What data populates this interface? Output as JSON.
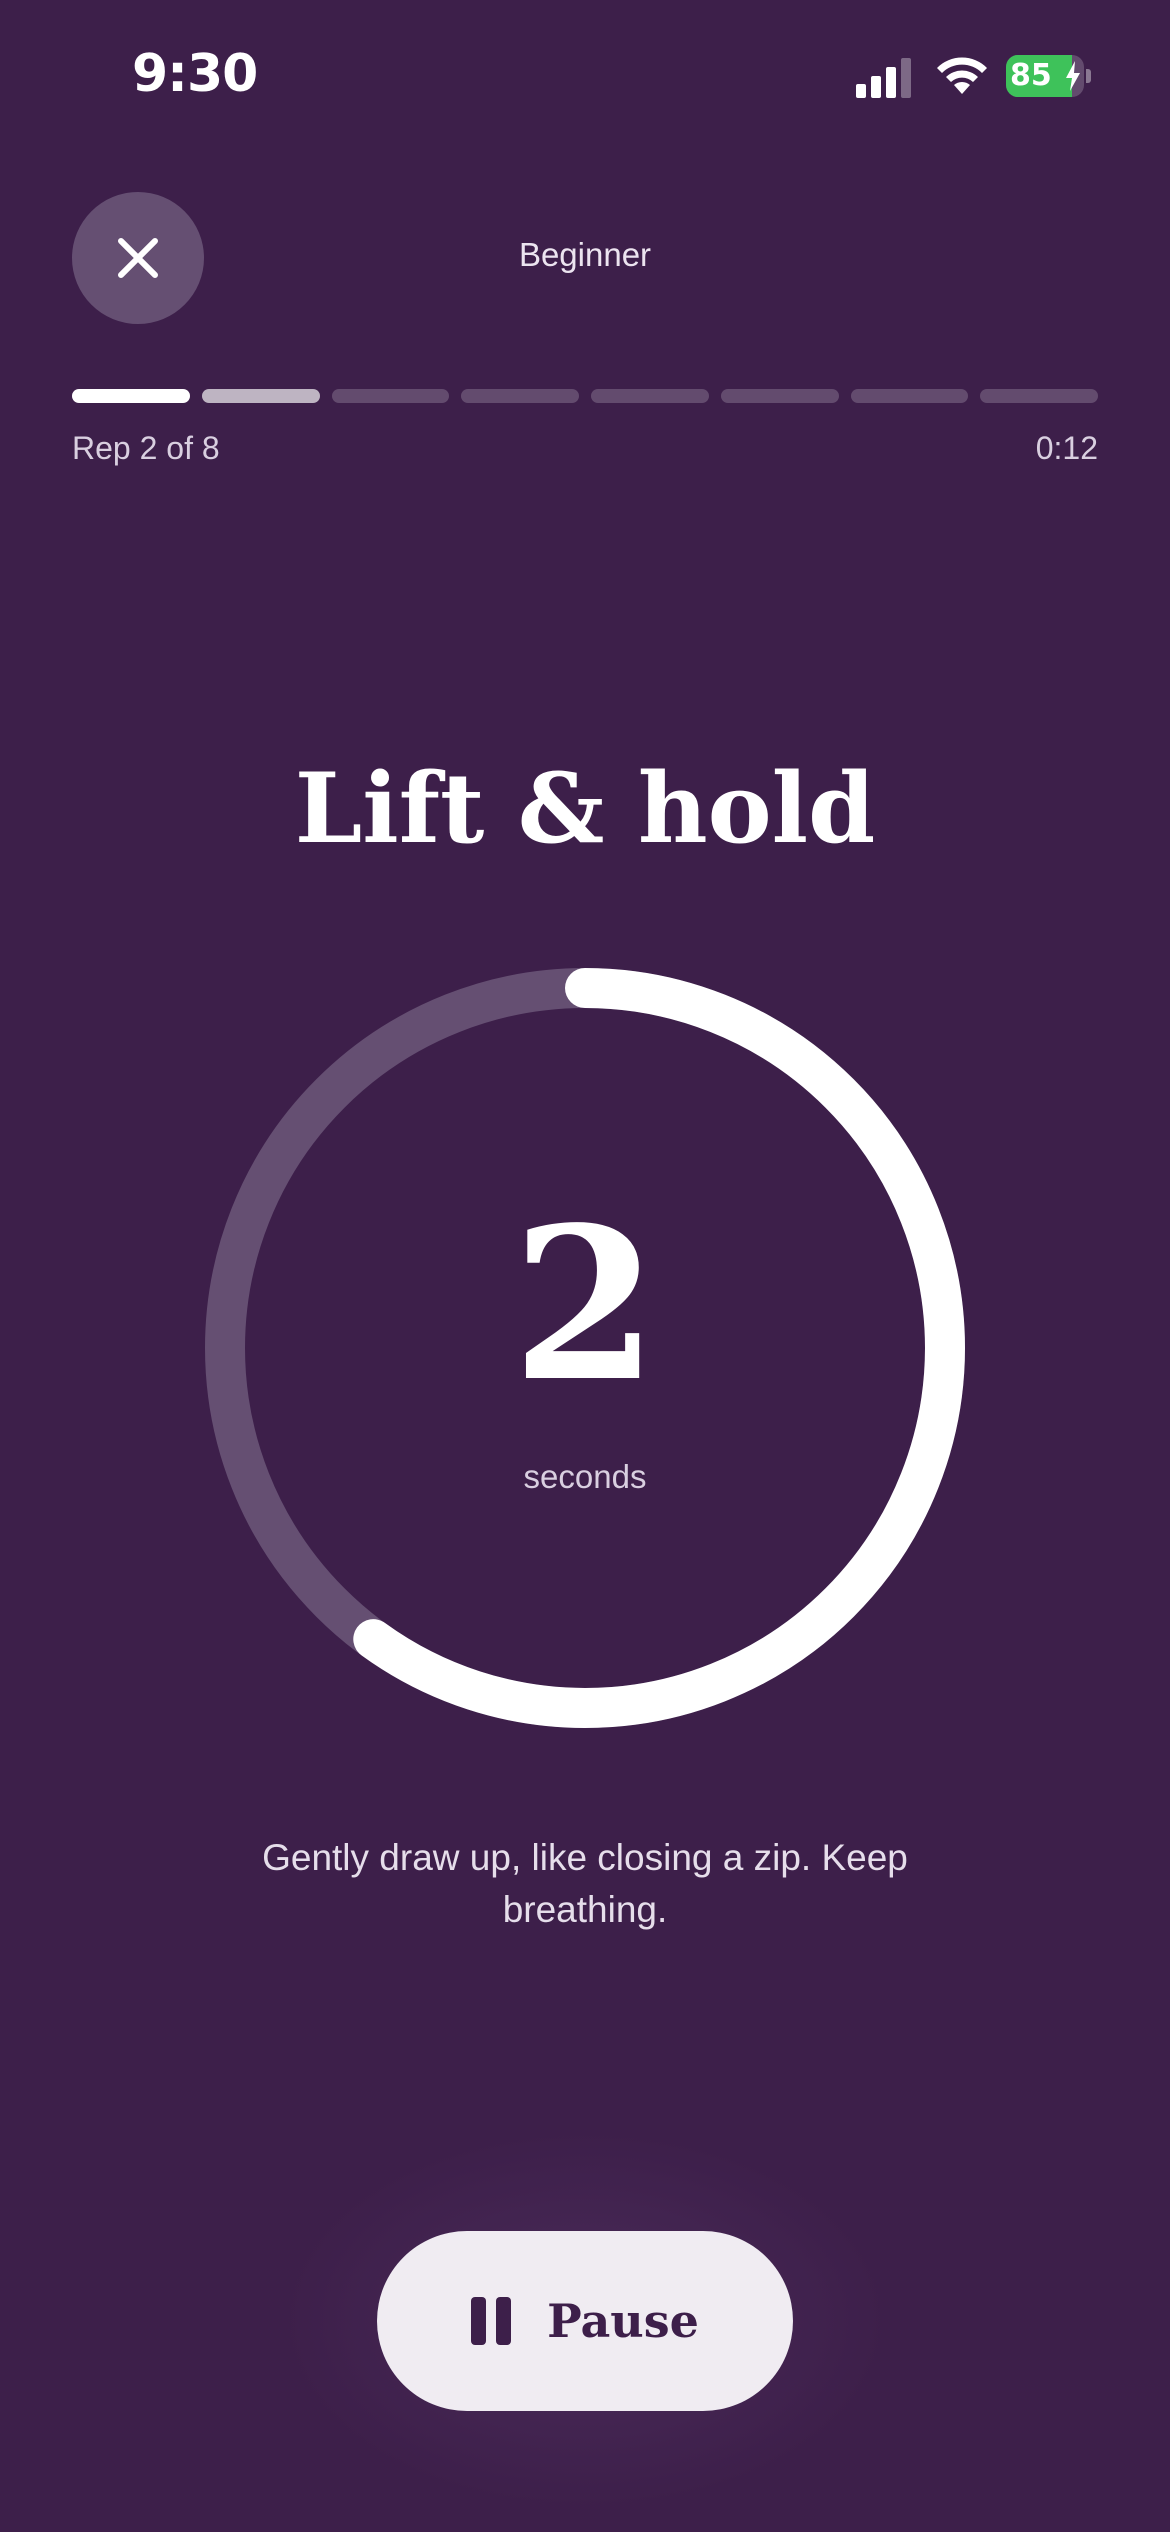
{
  "status_bar": {
    "time": "9:30",
    "battery_percent": "85",
    "battery_level": 0.85,
    "battery_color": "#3ec25a"
  },
  "header": {
    "title": "Beginner",
    "close_icon": "close-icon"
  },
  "progress": {
    "total_reps": 8,
    "completed_reps": 1,
    "current_rep": 2,
    "rep_label": "Rep 2 of 8",
    "elapsed": "0:12"
  },
  "exercise": {
    "phase_title": "Lift & hold",
    "countdown_value": "2",
    "countdown_unit": "seconds",
    "ring_fraction_remaining": 0.6,
    "instruction": "Gently draw up, like closing a zip. Keep breathing."
  },
  "controls": {
    "pause_label": "Pause",
    "pause_icon": "pause-icon"
  },
  "colors": {
    "background": "#3d1f4a",
    "accent": "#ffffff",
    "track": "#654f72"
  }
}
